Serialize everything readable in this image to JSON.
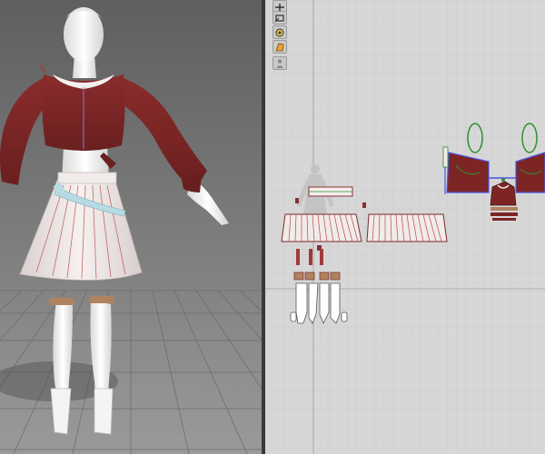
{
  "views": {
    "left": "3d-garment-view",
    "right": "2d-pattern-view"
  },
  "toolbar": {
    "tools": [
      {
        "icon": "select-move-icon"
      },
      {
        "icon": "transform-pattern-icon"
      },
      {
        "icon": "edit-point-icon"
      },
      {
        "icon": "fabric-texture-icon"
      },
      {
        "icon": "avatar-icon"
      }
    ]
  },
  "colors": {
    "viewport3d_bg": "#7f7f7f",
    "viewport2d_bg": "#d7d7d7",
    "top_fabric": "#7d2525",
    "skirt_fabric": "#efe8e6",
    "sash": "#b7dbe4",
    "avatar": "#f2f2f2",
    "stitch_line": "#b52c2c",
    "selected_outline": "#4a56e8",
    "internal_line": "#2f8f2f"
  }
}
